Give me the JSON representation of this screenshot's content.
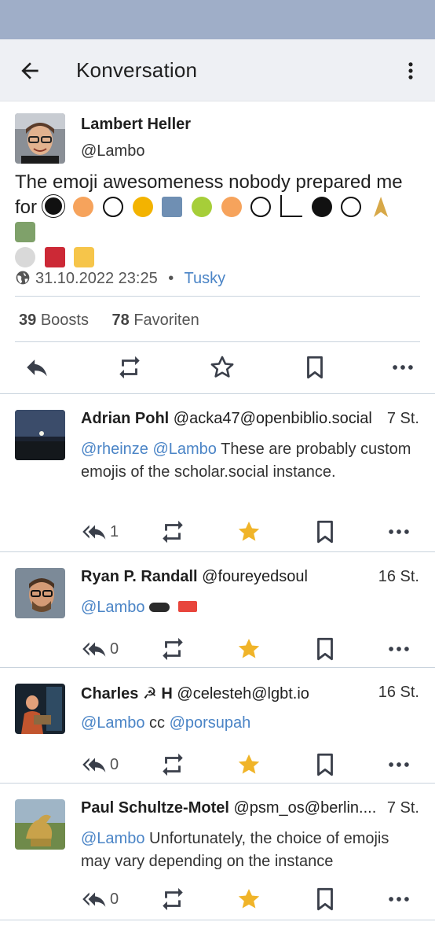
{
  "appbar": {
    "title": "Konversation"
  },
  "status": {
    "name": "Lambert Heller",
    "handle": "@Lambo",
    "text_line1": "The emoji awesomeness nobody prepared me",
    "text_line2_prefix": "for",
    "timestamp": "31.10.2022 23:25",
    "separator": "•",
    "client": "Tusky",
    "boosts_count": "39",
    "boosts_label": "Boosts",
    "favs_count": "78",
    "favs_label": "Favoriten"
  },
  "replies": [
    {
      "name": "Adrian Pohl",
      "handle": "@acka47@openbiblio.social",
      "time": "7 St.",
      "mentions": "@rheinze @Lambo",
      "text": "These are probably custom emojis of the scholar.social instance.",
      "reply_count": "1"
    },
    {
      "name": "Ryan P. Randall",
      "handle": "@foureyedsoul",
      "time": "16 St.",
      "mentions": "@Lambo",
      "text": "",
      "reply_count": "0"
    },
    {
      "name": "Charles ☭ H",
      "handle": "@celesteh@lgbt.io",
      "time": "16 St.",
      "mentions": "@Lambo",
      "text": "cc",
      "mention2": "@porsupah",
      "reply_count": "0"
    },
    {
      "name": "Paul Schultze-Motel",
      "handle": "@psm_os@berlin....",
      "time": "7 St.",
      "mentions": "@Lambo",
      "text": "Unfortunately, the choice of emojis may vary depending on the instance",
      "reply_count": "0"
    }
  ],
  "icons": {
    "back": "arrow-back-icon",
    "more": "more-vert-icon",
    "globe": "globe-icon",
    "reply": "reply-icon",
    "reply_all": "reply-all-icon",
    "boost": "boost-icon",
    "fav": "star-icon",
    "bookmark": "bookmark-icon",
    "overflow": "more-horiz-icon"
  },
  "colors": {
    "statusbar": "#9faec8",
    "appbar": "#eef0f4",
    "link": "#4a84c6",
    "star": "#f0b429",
    "icon": "#3a3f4a"
  }
}
